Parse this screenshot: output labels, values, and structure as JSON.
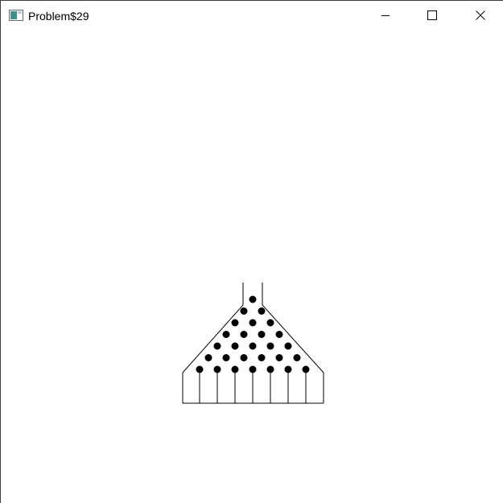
{
  "window": {
    "title": "Problem$29",
    "icon": "app-window-icon",
    "buttons": [
      {
        "name": "minimize-icon"
      },
      {
        "name": "maximize-icon"
      },
      {
        "name": "close-icon"
      }
    ]
  },
  "bean_machine": {
    "peg_rows": 7,
    "slots": 8,
    "colors": {
      "outline": "#000000",
      "peg": "#000000",
      "background": "#ffffff"
    }
  }
}
